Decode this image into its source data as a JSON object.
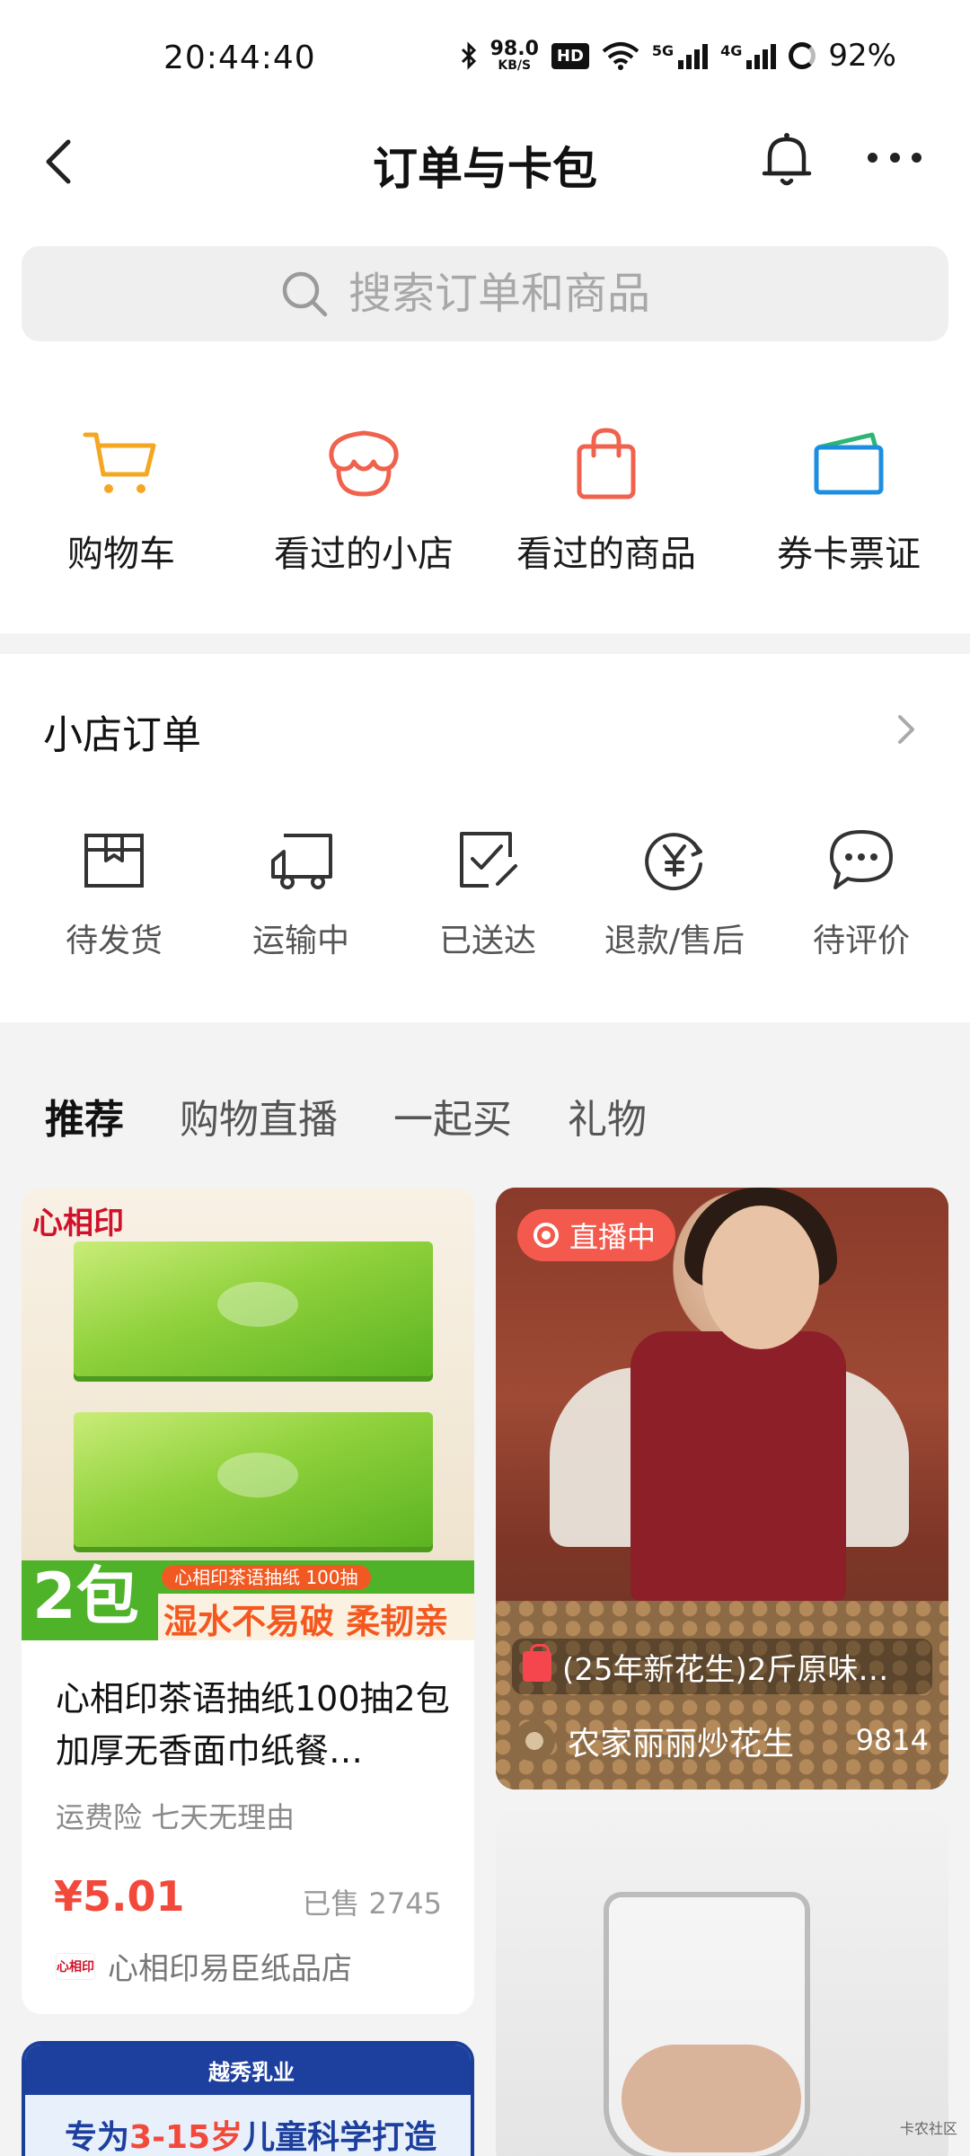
{
  "status_bar": {
    "time": "20:44:40",
    "net_speed_value": "98.0",
    "net_speed_unit": "KB/S",
    "hd_label": "HD",
    "sig1_label": "5G",
    "sig2_label": "4G",
    "battery": "92%"
  },
  "nav": {
    "title": "订单与卡包"
  },
  "search": {
    "placeholder": "搜索订单和商品"
  },
  "quick_entries": [
    {
      "label": "购物车",
      "icon": "cart-icon",
      "color": "#f5a623"
    },
    {
      "label": "看过的小店",
      "icon": "store-icon",
      "color": "#f0624d"
    },
    {
      "label": "看过的商品",
      "icon": "shopping-bag-icon",
      "color": "#f0624d"
    },
    {
      "label": "券卡票证",
      "icon": "wallet-icon",
      "color": "#1e8fe0"
    }
  ],
  "orders": {
    "title": "小店订单",
    "items": [
      {
        "label": "待发货",
        "icon": "package-icon"
      },
      {
        "label": "运输中",
        "icon": "truck-icon"
      },
      {
        "label": "已送达",
        "icon": "delivered-icon"
      },
      {
        "label": "退款/售后",
        "icon": "refund-icon"
      },
      {
        "label": "待评价",
        "icon": "comment-icon"
      }
    ]
  },
  "tabs": [
    "推荐",
    "购物直播",
    "一起买",
    "礼物"
  ],
  "feed": {
    "product": {
      "brand": "心相印",
      "promo_num": "2包",
      "promo_tag": "心相印茶语抽纸 100抽",
      "promo_text": "湿水不易破 柔韧亲肤",
      "title": "心相印茶语抽纸100抽2包加厚无香面巾纸餐…",
      "tags": "运费险 七天无理由",
      "price": "¥5.01",
      "sold": "已售 2745",
      "shop_name": "心相印易臣纸品店"
    },
    "live": {
      "badge": "直播中",
      "product": "(25年新花生)2斤原味…",
      "anchor": "农家丽丽炒花生",
      "viewers": "9814"
    },
    "dairy": {
      "brand": "越秀乳业",
      "headline_pre": "专为",
      "headline_em": "3-15岁",
      "headline_post": "儿童科学打造"
    }
  },
  "watermark": "卡农社区",
  "accent_color": "#f2493a"
}
